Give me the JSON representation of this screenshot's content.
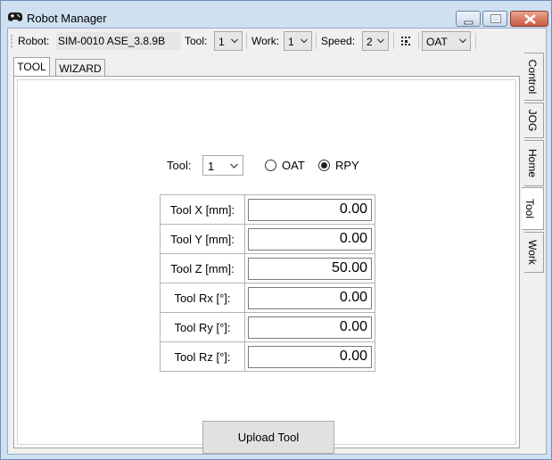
{
  "window": {
    "title": "Robot Manager",
    "icon": "gamepad-icon"
  },
  "toolbar": {
    "robot_label": "Robot:",
    "robot_value": "SIM-0010 ASE_3.8.9B",
    "tool_label": "Tool:",
    "tool_value": "1",
    "work_label": "Work:",
    "work_value": "1",
    "speed_label": "Speed:",
    "speed_value": "2",
    "frame_icon": "frame-grid-icon",
    "orientation_value": "OAT"
  },
  "tabs": [
    {
      "label": "TOOL",
      "active": true
    },
    {
      "label": "WIZARD",
      "active": false
    }
  ],
  "side_tabs": [
    {
      "label": "Control",
      "active": false
    },
    {
      "label": "JOG",
      "active": false
    },
    {
      "label": "Home",
      "active": false
    },
    {
      "label": "Tool",
      "active": true
    },
    {
      "label": "Work",
      "active": false
    }
  ],
  "tool_panel": {
    "tool_label": "Tool:",
    "tool_value": "1",
    "radio_oat": "OAT",
    "radio_rpy": "RPY",
    "selected_mode": "RPY",
    "params": [
      {
        "label": "Tool X [mm]:",
        "value": "0.00"
      },
      {
        "label": "Tool Y [mm]:",
        "value": "0.00"
      },
      {
        "label": "Tool Z [mm]:",
        "value": "50.00"
      },
      {
        "label": "Tool Rx [°]:",
        "value": "0.00"
      },
      {
        "label": "Tool Ry [°]:",
        "value": "0.00"
      },
      {
        "label": "Tool Rz [°]:",
        "value": "0.00"
      }
    ],
    "upload_label": "Upload Tool"
  }
}
